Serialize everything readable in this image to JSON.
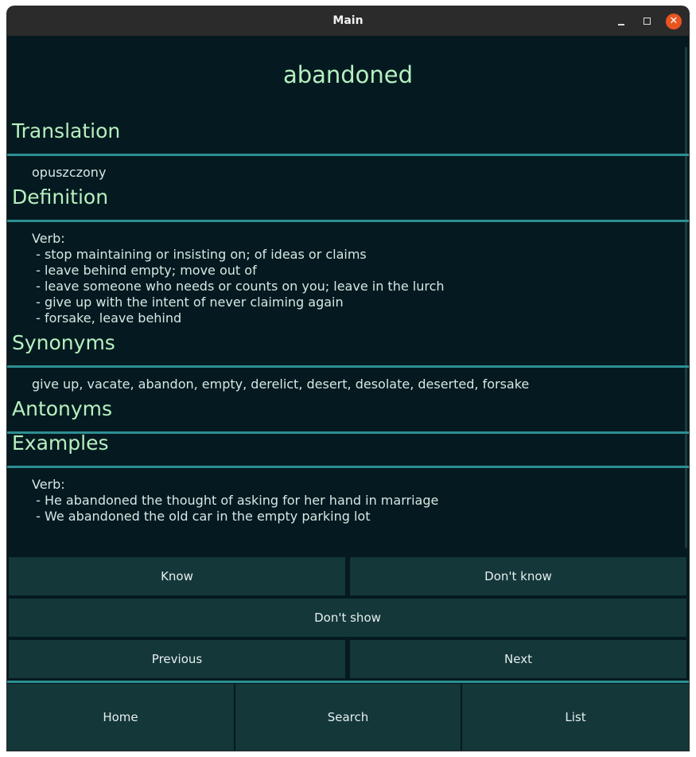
{
  "window": {
    "title": "Main",
    "close_glyph": "✕"
  },
  "word": "abandoned",
  "sections": {
    "translation": {
      "title": "Translation",
      "lines": [
        "opuszczony"
      ]
    },
    "definition": {
      "title": "Definition",
      "lines": [
        "Verb:",
        " - stop maintaining or insisting on; of ideas or claims",
        " - leave behind empty; move out of",
        " - leave someone who needs or counts on you; leave in the lurch",
        " - give up with the intent of never claiming again",
        " - forsake, leave behind"
      ]
    },
    "synonyms": {
      "title": "Synonyms",
      "lines": [
        "give up, vacate, abandon, empty, derelict, desert, desolate, deserted, forsake"
      ]
    },
    "antonyms": {
      "title": "Antonyms"
    },
    "examples": {
      "title": "Examples",
      "lines": [
        "Verb:",
        " - He abandoned the thought of asking for her hand in marriage",
        " - We abandoned the old car in the empty parking lot"
      ]
    }
  },
  "buttons": {
    "know": "Know",
    "dont_know": "Don't know",
    "dont_show": "Don't show",
    "previous": "Previous",
    "next": "Next"
  },
  "nav": {
    "home": "Home",
    "search": "Search",
    "list": "List"
  },
  "colors": {
    "background": "#051a20",
    "heading": "#b7f0c0",
    "accent_rule": "#2c8f93",
    "button": "#14373a",
    "close": "#e9541f"
  }
}
